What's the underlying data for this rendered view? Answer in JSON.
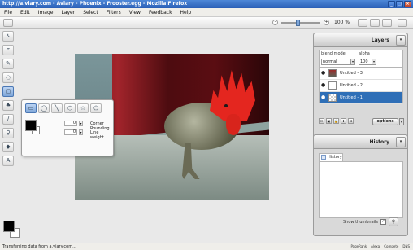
{
  "window": {
    "title": "http://a.viary.com - Aviary - Phoenix - Frooster.egg - Mozilla Firefox",
    "minimize": "_",
    "maximize": "□",
    "close": "×"
  },
  "menu": {
    "items": [
      "File",
      "Edit",
      "Image",
      "Layer",
      "Select",
      "Filters",
      "View",
      "Feedback",
      "Help"
    ]
  },
  "zoom": {
    "minus": "-",
    "plus": "+",
    "value": "100 %",
    "level_fraction": 0.42
  },
  "tools": [
    {
      "icon": "move-icon",
      "glyph": "↖"
    },
    {
      "icon": "crop-icon",
      "glyph": "⌗"
    },
    {
      "icon": "pencil-icon",
      "glyph": "✎"
    },
    {
      "icon": "lasso-icon",
      "glyph": "◌"
    },
    {
      "icon": "shape-icon",
      "glyph": "▢"
    },
    {
      "icon": "stamp-icon",
      "glyph": "♣"
    },
    {
      "icon": "brush-icon",
      "glyph": "/"
    },
    {
      "icon": "eyedropper-icon",
      "glyph": "⚲"
    },
    {
      "icon": "bucket-icon",
      "glyph": "◆"
    },
    {
      "icon": "text-icon",
      "glyph": "A"
    }
  ],
  "shape_panel": {
    "shapes": [
      {
        "icon": "rectangle-icon",
        "glyph": "▭"
      },
      {
        "icon": "ellipse-icon",
        "glyph": "◯"
      },
      {
        "icon": "line-icon",
        "glyph": "╲"
      },
      {
        "icon": "polygon-icon",
        "glyph": "⬡"
      },
      {
        "icon": "star-icon",
        "glyph": "☆"
      },
      {
        "icon": "custom-shape-icon",
        "glyph": "⬠"
      }
    ],
    "corner_rounding_value": "0",
    "corner_rounding_label": "Corner Rounding",
    "line_weight_value": "0",
    "line_weight_label": "Line weight",
    "stepper": "▾"
  },
  "layers": {
    "title": "Layers",
    "blend_mode_label": "blend mode",
    "blend_mode_value": "normal",
    "alpha_label": "alpha",
    "alpha_value": "100",
    "rows": [
      {
        "name": "Untitled - 3",
        "thumb": "img",
        "visible": true
      },
      {
        "name": "Untitled - 2",
        "thumb": "plain",
        "visible": true
      },
      {
        "name": "Untitled - 1",
        "thumb": "checker",
        "visible": true,
        "selected": true
      }
    ],
    "options_label": "options",
    "tool_glyphs": [
      "✉",
      "▣",
      "🔒",
      "✚",
      "✖"
    ]
  },
  "history": {
    "title": "History",
    "tab_label": "History",
    "show_thumbnails_label": "Show thumbnails",
    "show_thumbnails_checked": "✓"
  },
  "status": {
    "text": "Transferring data from a.viary.com...",
    "right_items": [
      "PageRank",
      "Alexa",
      "Compete",
      "DNS"
    ]
  },
  "colors": {
    "accent": "#2f6fb7",
    "titlebar": "#2a5fb6",
    "foreground_swatch": "#000000",
    "background_swatch": "#ffffff"
  }
}
